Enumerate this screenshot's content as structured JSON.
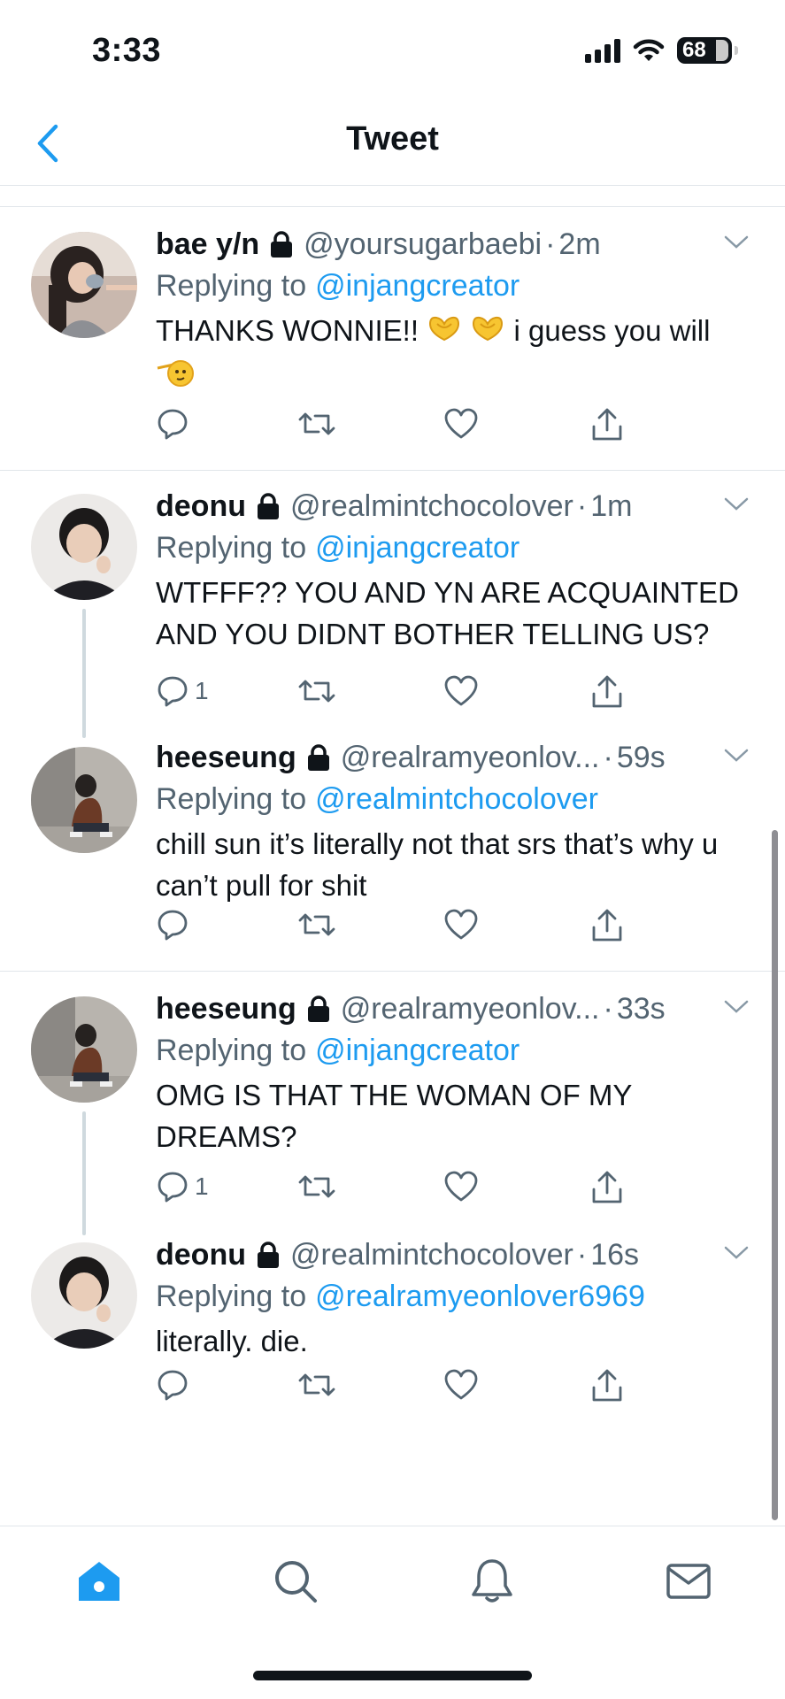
{
  "status_bar": {
    "time": "3:33",
    "battery": "68"
  },
  "header": {
    "title": "Tweet"
  },
  "tweets": [
    {
      "name": "bae y/n",
      "handle": "@yoursugarbaebi",
      "time": "2m",
      "replying_label": "Replying to",
      "replying_to": "@injangcreator",
      "text_a": "THANKS WONNIE!!",
      "text_b": "i guess you will",
      "reply_count": ""
    },
    {
      "name": "deonu",
      "handle": "@realmintchocolover",
      "time": "1m",
      "replying_label": "Replying to",
      "replying_to": "@injangcreator",
      "text": "WTFFF?? YOU AND YN ARE ACQUAINTED AND YOU DIDNT BOTHER TELLING US?",
      "reply_count": "1"
    },
    {
      "name": "heeseung",
      "handle": "@realramyeonlov...",
      "time": "59s",
      "replying_label": "Replying to",
      "replying_to": "@realmintchocolover",
      "text": "chill sun it’s literally not that srs that’s why u can’t pull for shit",
      "reply_count": ""
    },
    {
      "name": "heeseung",
      "handle": "@realramyeonlov...",
      "time": "33s",
      "replying_label": "Replying to",
      "replying_to": "@injangcreator",
      "text": "OMG IS THAT THE WOMAN OF MY DREAMS?",
      "reply_count": "1"
    },
    {
      "name": "deonu",
      "handle": "@realmintchocolover",
      "time": "16s",
      "replying_label": "Replying to",
      "replying_to": "@realramyeonlover6969",
      "text": "literally. die.",
      "reply_count": ""
    }
  ],
  "tabs": [
    {
      "icon": "home-icon"
    },
    {
      "icon": "search-icon"
    },
    {
      "icon": "bell-icon"
    },
    {
      "icon": "mail-icon"
    }
  ],
  "colors": {
    "accent": "#1d9bf0",
    "secondary_text": "#536471",
    "primary_text": "#0f1419",
    "divider": "#e1e6ea"
  }
}
